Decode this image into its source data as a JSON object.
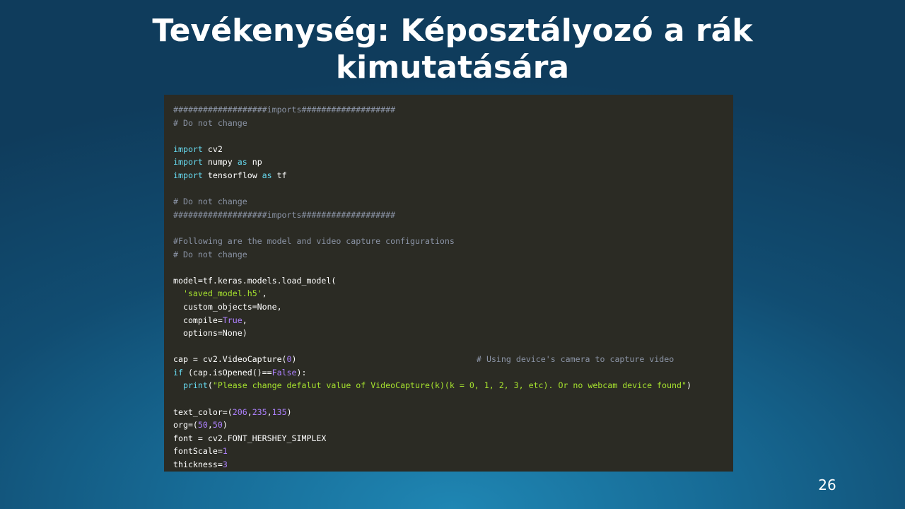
{
  "slide": {
    "title": "Tevékenység: Képosztályozó a rák kimutatására",
    "page_number": "26"
  },
  "code": {
    "l01": "###################imports###################",
    "l02": "# Do not change",
    "l04_kw": "import",
    "l04_rest": " cv2",
    "l05_kw": "import",
    "l05_mid": " numpy ",
    "l05_kw2": "as",
    "l05_rest": " np",
    "l06_kw": "import",
    "l06_mid": " tensorflow ",
    "l06_kw2": "as",
    "l06_rest": " tf",
    "l08": "# Do not change",
    "l09": "###################imports###################",
    "l11": "#Following are the model and video capture configurations",
    "l12": "# Do not change",
    "l14": "model=tf.keras.models.load_model(",
    "l15_indent": "  ",
    "l15_str": "'saved_model.h5'",
    "l15_rest": ",",
    "l16": "  custom_objects=None,",
    "l17_a": "  compile=",
    "l17_true": "True",
    "l17_b": ",",
    "l18": "  options=None)",
    "l20_a": "cap = cv2.VideoCapture(",
    "l20_num": "0",
    "l20_b": ")",
    "l20_comment": "# Using device's camera to capture video",
    "l21_kw": "if",
    "l21_a": " (cap.isOpened()==",
    "l21_false": "False",
    "l21_b": "):",
    "l22_indent": "  ",
    "l22_kw": "print",
    "l22_a": "(",
    "l22_str": "\"Please change defalut value of VideoCapture(k)(k = 0, 1, 2, 3, etc). Or no webcam device found\"",
    "l22_b": ")",
    "l24_a": "text_color=(",
    "l24_n1": "206",
    "l24_c1": ",",
    "l24_n2": "235",
    "l24_c2": ",",
    "l24_n3": "135",
    "l24_b": ")",
    "l25_a": "org=(",
    "l25_n1": "50",
    "l25_c1": ",",
    "l25_n2": "50",
    "l25_b": ")",
    "l26": "font = cv2.FONT_HERSHEY_SIMPLEX",
    "l27_a": "fontScale=",
    "l27_n": "1",
    "l28_a": "thickness=",
    "l28_n": "3"
  }
}
